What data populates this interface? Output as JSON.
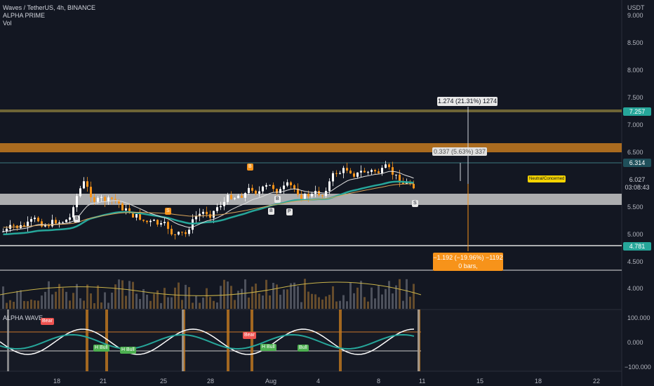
{
  "header": {
    "symbol": "Waves / TetherUS, 4h, BINANCE",
    "indicator1": "ALPHA PRIME",
    "indicator2": "Vol",
    "oscillator": "ALPHA WAVE"
  },
  "price_axis": {
    "currency": "USDT",
    "ticks": [
      "9.000",
      "8.500",
      "8.000",
      "7.500",
      "7.000",
      "6.500",
      "5.500",
      "5.000",
      "4.500",
      "4.000"
    ],
    "tags": {
      "target": {
        "label": "7.257",
        "color": "#26a69a"
      },
      "resistance": {
        "label": "6.314",
        "color": "#1f4f5a"
      },
      "current": {
        "label": "6.027",
        "sub": "03:08:43",
        "color": "#131722"
      },
      "support": {
        "label": "4.781",
        "color": "#26a69a"
      }
    }
  },
  "oscillator_axis": {
    "ticks": [
      "100.000",
      "0.000",
      "−100.000"
    ]
  },
  "time_axis": {
    "ticks": [
      "18",
      "21",
      "25",
      "28",
      "Aug",
      "4",
      "8",
      "11",
      "15",
      "18",
      "22"
    ]
  },
  "measurements": {
    "up": "1.274 (21.31%) 1274",
    "mid": "0.337 (5.63%) 337",
    "down_line1": "−1.192 (−19.96%) −1192",
    "down_line2": "0 bars,"
  },
  "annotations": {
    "neutral": "Neutral/Concerned",
    "signals": [
      "B",
      "B",
      "B",
      "P",
      "S",
      "S",
      "B"
    ],
    "osc_labels": [
      "Bear",
      "Bear",
      "H Bull",
      "H Bull",
      "H Bull",
      "Bull"
    ]
  },
  "colors": {
    "up_candle": "#ffffff",
    "down_candle": "#f7931a",
    "orange_zone": "#c67a1f",
    "gray_zone": "#c8c8c8",
    "teal": "#26a69a",
    "bull_label": "#4caf50",
    "bear_label": "#ef5350"
  }
}
